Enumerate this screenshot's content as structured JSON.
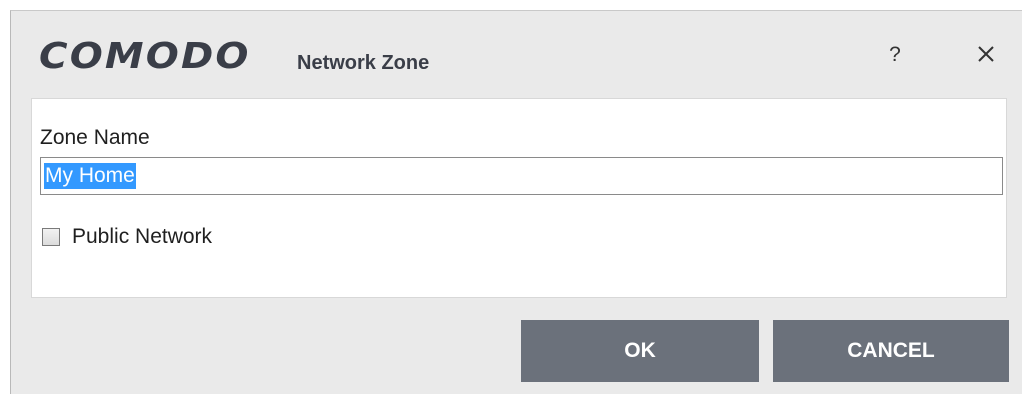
{
  "titlebar": {
    "brand": "COMODO",
    "title": "Network Zone",
    "help_label": "?",
    "close_icon": "close-icon"
  },
  "form": {
    "zone_name_label": "Zone Name",
    "zone_name_value": "My Home",
    "public_network_label": "Public Network",
    "public_network_checked": false
  },
  "buttons": {
    "ok_label": "OK",
    "cancel_label": "CANCEL"
  },
  "colors": {
    "dialog_bg": "#eaeaea",
    "button_bg": "#6b717b",
    "selection": "#3399ff",
    "brand_text": "#3a3e48"
  }
}
